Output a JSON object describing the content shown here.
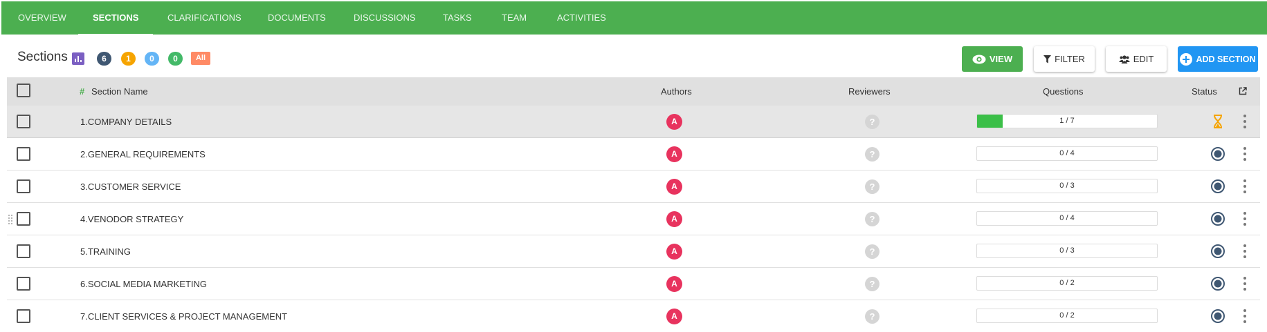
{
  "tabs": [
    {
      "label": "Overview"
    },
    {
      "label": "Sections"
    },
    {
      "label": "Clarifications"
    },
    {
      "label": "Documents"
    },
    {
      "label": "Discussions"
    },
    {
      "label": "Tasks"
    },
    {
      "label": "Team"
    },
    {
      "label": "Activities"
    }
  ],
  "header": {
    "title": "Sections",
    "badges": [
      {
        "value": "6",
        "color": "#3f5772"
      },
      {
        "value": "1",
        "color": "#f6a400"
      },
      {
        "value": "0",
        "color": "#64b5f6"
      },
      {
        "value": "0",
        "color": "#43b968"
      }
    ],
    "all_label": "All"
  },
  "toolbar": {
    "view_label": "VIEW",
    "filter_label": "FILTER",
    "edit_label": "EDIT",
    "add_label": "ADD SECTION"
  },
  "columns": {
    "section_name": "Section Name",
    "authors": "Authors",
    "reviewers": "Reviewers",
    "questions": "Questions",
    "status": "Status"
  },
  "rows": [
    {
      "name": "1.COMPANY DETAILS",
      "author": "A",
      "answered": 1,
      "total": 7,
      "questions": "1 / 7",
      "status": "in-progress"
    },
    {
      "name": "2.GENERAL REQUIREMENTS",
      "author": "A",
      "answered": 0,
      "total": 4,
      "questions": "0 / 4",
      "status": "not-started"
    },
    {
      "name": "3.CUSTOMER SERVICE",
      "author": "A",
      "answered": 0,
      "total": 3,
      "questions": "0 / 3",
      "status": "not-started"
    },
    {
      "name": "4.VENODOR STRATEGY",
      "author": "A",
      "answered": 0,
      "total": 4,
      "questions": "0 / 4",
      "status": "not-started"
    },
    {
      "name": "5.TRAINING",
      "author": "A",
      "answered": 0,
      "total": 3,
      "questions": "0 / 3",
      "status": "not-started"
    },
    {
      "name": "6.SOCIAL MEDIA MARKETING",
      "author": "A",
      "answered": 0,
      "total": 2,
      "questions": "0 / 2",
      "status": "not-started"
    },
    {
      "name": "7.CLIENT SERVICES & PROJECT MANAGEMENT",
      "author": "A",
      "answered": 0,
      "total": 2,
      "questions": "0 / 2",
      "status": "not-started"
    }
  ],
  "colors": {
    "nav_green": "#4caf50",
    "view_green": "#4caf50",
    "add_blue": "#2196f3",
    "author_red": "#e8335e",
    "progress_green": "#3bbf48",
    "hourglass_orange": "#f6a400",
    "status_navy": "#3f5772",
    "hash_green": "#4caf50"
  }
}
